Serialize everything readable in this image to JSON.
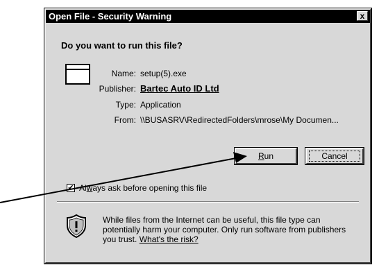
{
  "window": {
    "title": "Open File - Security Warning",
    "close_glyph": "x"
  },
  "dialog": {
    "question": "Do you want to run this file?",
    "fields": [
      {
        "label": "Name:",
        "value": "setup(5).exe"
      },
      {
        "label": "Publisher:",
        "value": "Bartec Auto ID Ltd"
      },
      {
        "label": "Type:",
        "value": "Application"
      },
      {
        "label": "From:",
        "value": "\\\\BUSASRV\\RedirectedFolders\\mrose\\My Documen..."
      }
    ],
    "buttons": {
      "run_accel": "R",
      "run_rest": "un",
      "cancel": "Cancel"
    },
    "checkbox": {
      "checked": true,
      "check_glyph": "✔",
      "label_pre": "Al",
      "label_accel": "w",
      "label_post": "ays ask before opening this file"
    },
    "warning": {
      "text": "While files from the Internet can be useful, this file type can potentially harm your computer. Only run software from publishers you trust.",
      "link": "What's the risk?"
    }
  },
  "icons": {
    "app": "application-window-icon",
    "shield": "security-shield-icon"
  },
  "annotation": {
    "color": "#000000"
  }
}
